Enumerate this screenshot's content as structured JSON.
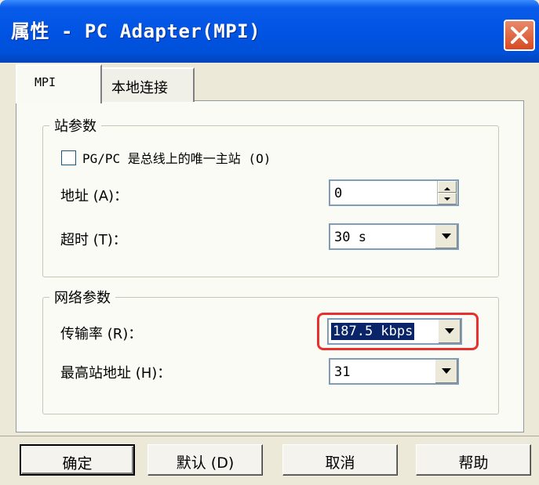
{
  "window": {
    "title": "属性 - PC Adapter(MPI)",
    "title_bar_color": "#0054e3",
    "close_button_color": "#d74a23"
  },
  "tabs": [
    {
      "label": "MPI",
      "active": true
    },
    {
      "label": "本地连接",
      "active": false
    }
  ],
  "station_params": {
    "legend": "站参数",
    "only_master": {
      "label": "PG/PC 是总线上的唯一主站 (O)",
      "checked": false
    },
    "address": {
      "label": "地址 (A)：",
      "value": "0"
    },
    "timeout": {
      "label": "超时 (T)：",
      "value": "30 s"
    }
  },
  "network_params": {
    "legend": "网络参数",
    "transmission_rate": {
      "label": "传输率 (R)：",
      "value": "187.5 kbps",
      "highlight_color": "#e8302e"
    },
    "highest_address": {
      "label": "最高站地址 (H)：",
      "value": "31"
    }
  },
  "buttons": {
    "ok": "确定",
    "default": "默认 (D)",
    "cancel": "取消",
    "help": "帮助"
  }
}
